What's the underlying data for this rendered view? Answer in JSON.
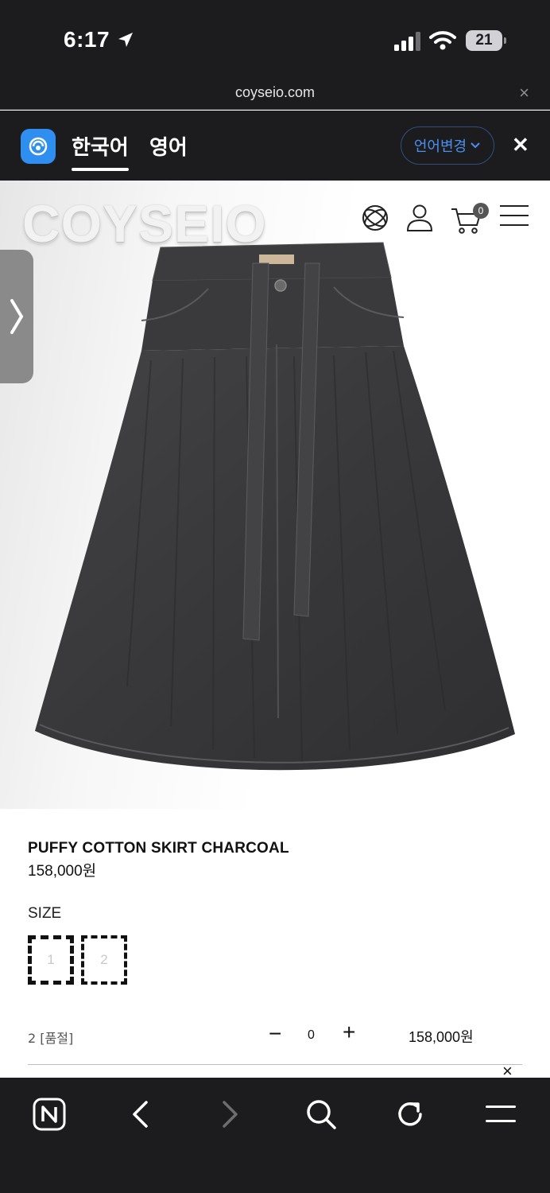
{
  "status_bar": {
    "time": "6:17",
    "battery": "21"
  },
  "url_bar": {
    "url": "coyseio.com",
    "close": "×"
  },
  "translate_bar": {
    "lang_source": "한국어",
    "lang_target": "영어",
    "change_button": "언어변경",
    "close": "✕"
  },
  "site_header": {
    "brand": "COYSEIO",
    "cart_count": "0",
    "icons": [
      "globe-icon",
      "user-icon",
      "cart-icon",
      "menu-icon"
    ]
  },
  "product": {
    "name": "PUFFY COTTON SKIRT CHARCOAL",
    "price": "158,000원",
    "size_label": "SIZE",
    "sizes": [
      "1",
      "2"
    ]
  },
  "selected_option": {
    "label": "2 [품절]",
    "minus": "−",
    "quantity": "0",
    "plus": "+",
    "price": "158,000원",
    "remove": "×"
  },
  "toolbar": {
    "items": [
      "naver-home-icon",
      "back-icon",
      "forward-icon",
      "search-icon",
      "refresh-icon",
      "menu-icon"
    ]
  },
  "colors": {
    "chrome_dark": "#1c1c1e",
    "papago_blue": "#2e8ff0",
    "link_blue": "#4b8ef2",
    "skirt_charcoal": "#3b3b3d"
  }
}
